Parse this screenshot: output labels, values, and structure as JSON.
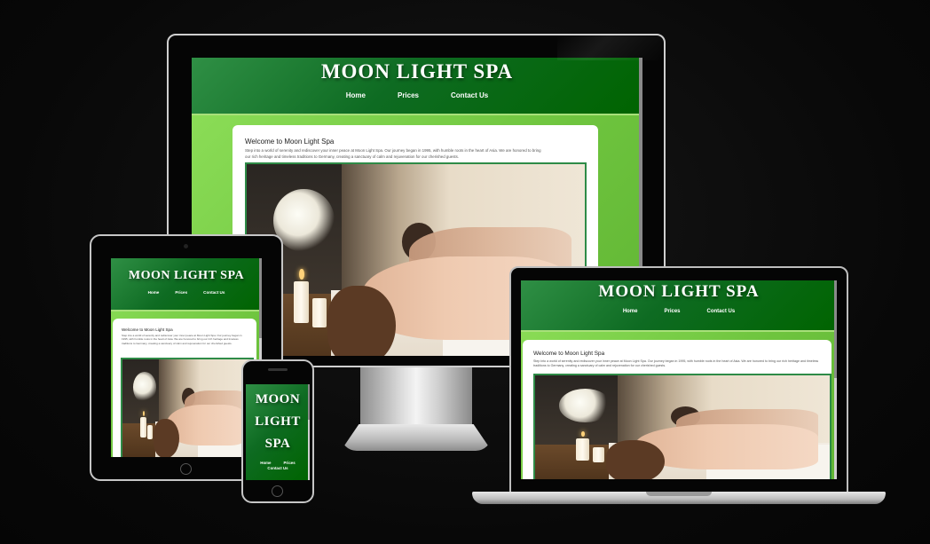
{
  "site": {
    "title": "MOON LIGHT SPA",
    "title_words": [
      "MOON",
      "LIGHT",
      "SPA"
    ],
    "nav": [
      "Home",
      "Prices",
      "Contact Us"
    ],
    "welcome_heading": "Welcome to Moon Light Spa",
    "welcome_text": "Step into a world of serenity and rediscover your inner peace at Moon Light Spa. Our journey began in 1995, with humble roots in the heart of Asia. We are honored to bring our rich heritage and timeless traditions to Germany, creating a sanctuary of calm and rejuvenation for our cherished guests.",
    "hero_image": "spa-couple-massage-photo"
  },
  "devices": [
    "monitor",
    "laptop",
    "tablet",
    "phone"
  ],
  "colors": {
    "background": "#0b0b0b",
    "header_green": "#006400",
    "page_green": "#7dd24b",
    "photo_border": "#2e8b47"
  }
}
